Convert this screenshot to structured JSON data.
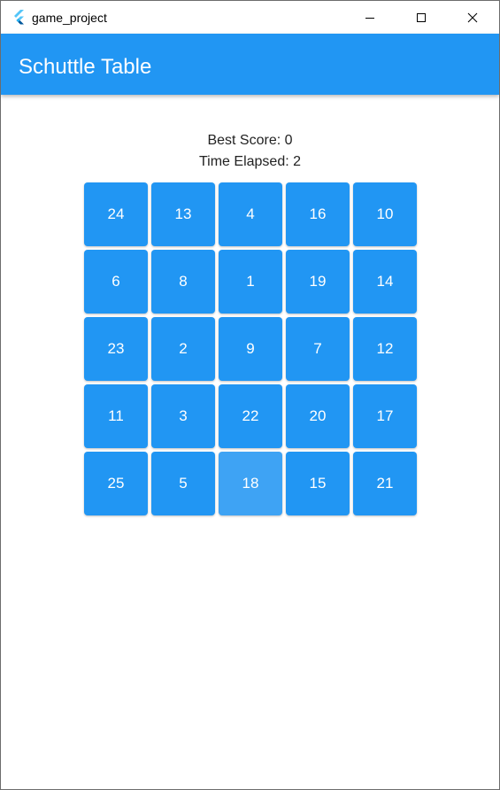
{
  "window": {
    "title": "game_project",
    "icon": "flutter-logo-icon",
    "controls": [
      "minimize-icon",
      "maximize-icon",
      "close-icon"
    ]
  },
  "appbar": {
    "title": "Schuttle Table",
    "color": "#2196f3"
  },
  "stats": {
    "best_score": "Best Score: 0",
    "time_elapsed": "Time Elapsed: 2"
  },
  "grid": {
    "tile_color": "#2196f3",
    "highlighted_tile_color": "#3ea3f4",
    "highlighted_value": "18",
    "tiles": [
      "24",
      "13",
      "4",
      "16",
      "10",
      "6",
      "8",
      "1",
      "19",
      "14",
      "23",
      "2",
      "9",
      "7",
      "12",
      "11",
      "3",
      "22",
      "20",
      "17",
      "25",
      "5",
      "18",
      "15",
      "21"
    ]
  }
}
